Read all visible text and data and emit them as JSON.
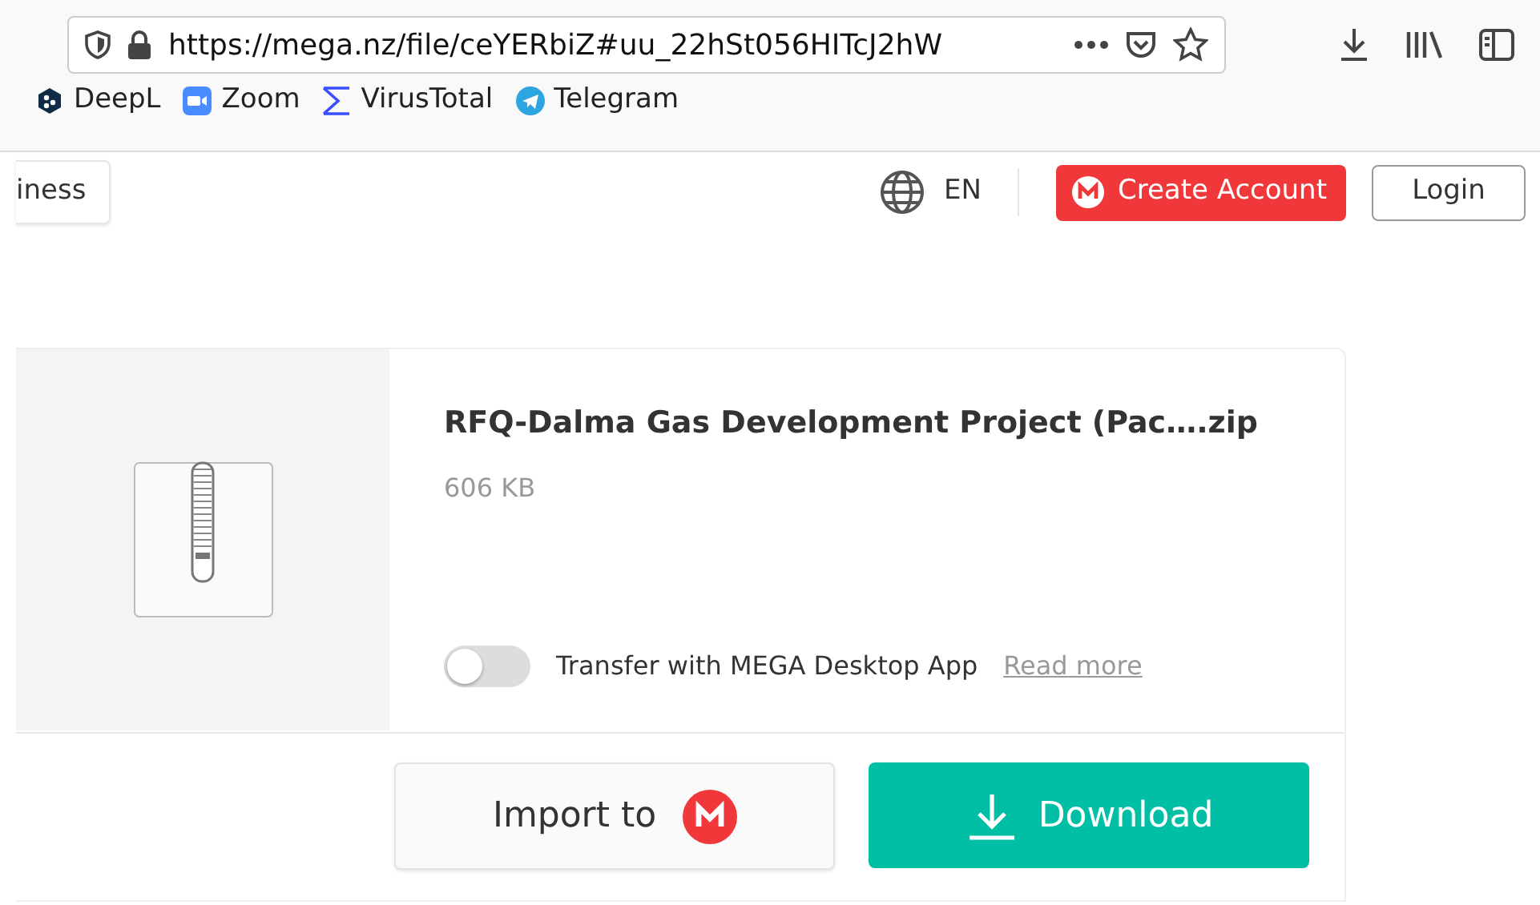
{
  "browser": {
    "url": "https://mega.nz/file/ceYERbiZ#uu_22hSt056HITcJ2hW",
    "bookmarks": [
      {
        "label": "DeepL",
        "kind": "deepl"
      },
      {
        "label": "Zoom",
        "kind": "zoom"
      },
      {
        "label": "VirusTotal",
        "kind": "virustotal"
      },
      {
        "label": "Telegram",
        "kind": "telegram"
      }
    ]
  },
  "header": {
    "business_button": "iness",
    "language": "EN",
    "create_account": "Create Account",
    "login": "Login"
  },
  "file": {
    "name": "RFQ-Dalma Gas Development Project (Pac….zip",
    "size": "606 KB",
    "transfer_toggle": {
      "label": "Transfer with MEGA Desktop App",
      "on": false
    },
    "read_more": "Read more"
  },
  "actions": {
    "import": "Import to",
    "download": "Download"
  }
}
